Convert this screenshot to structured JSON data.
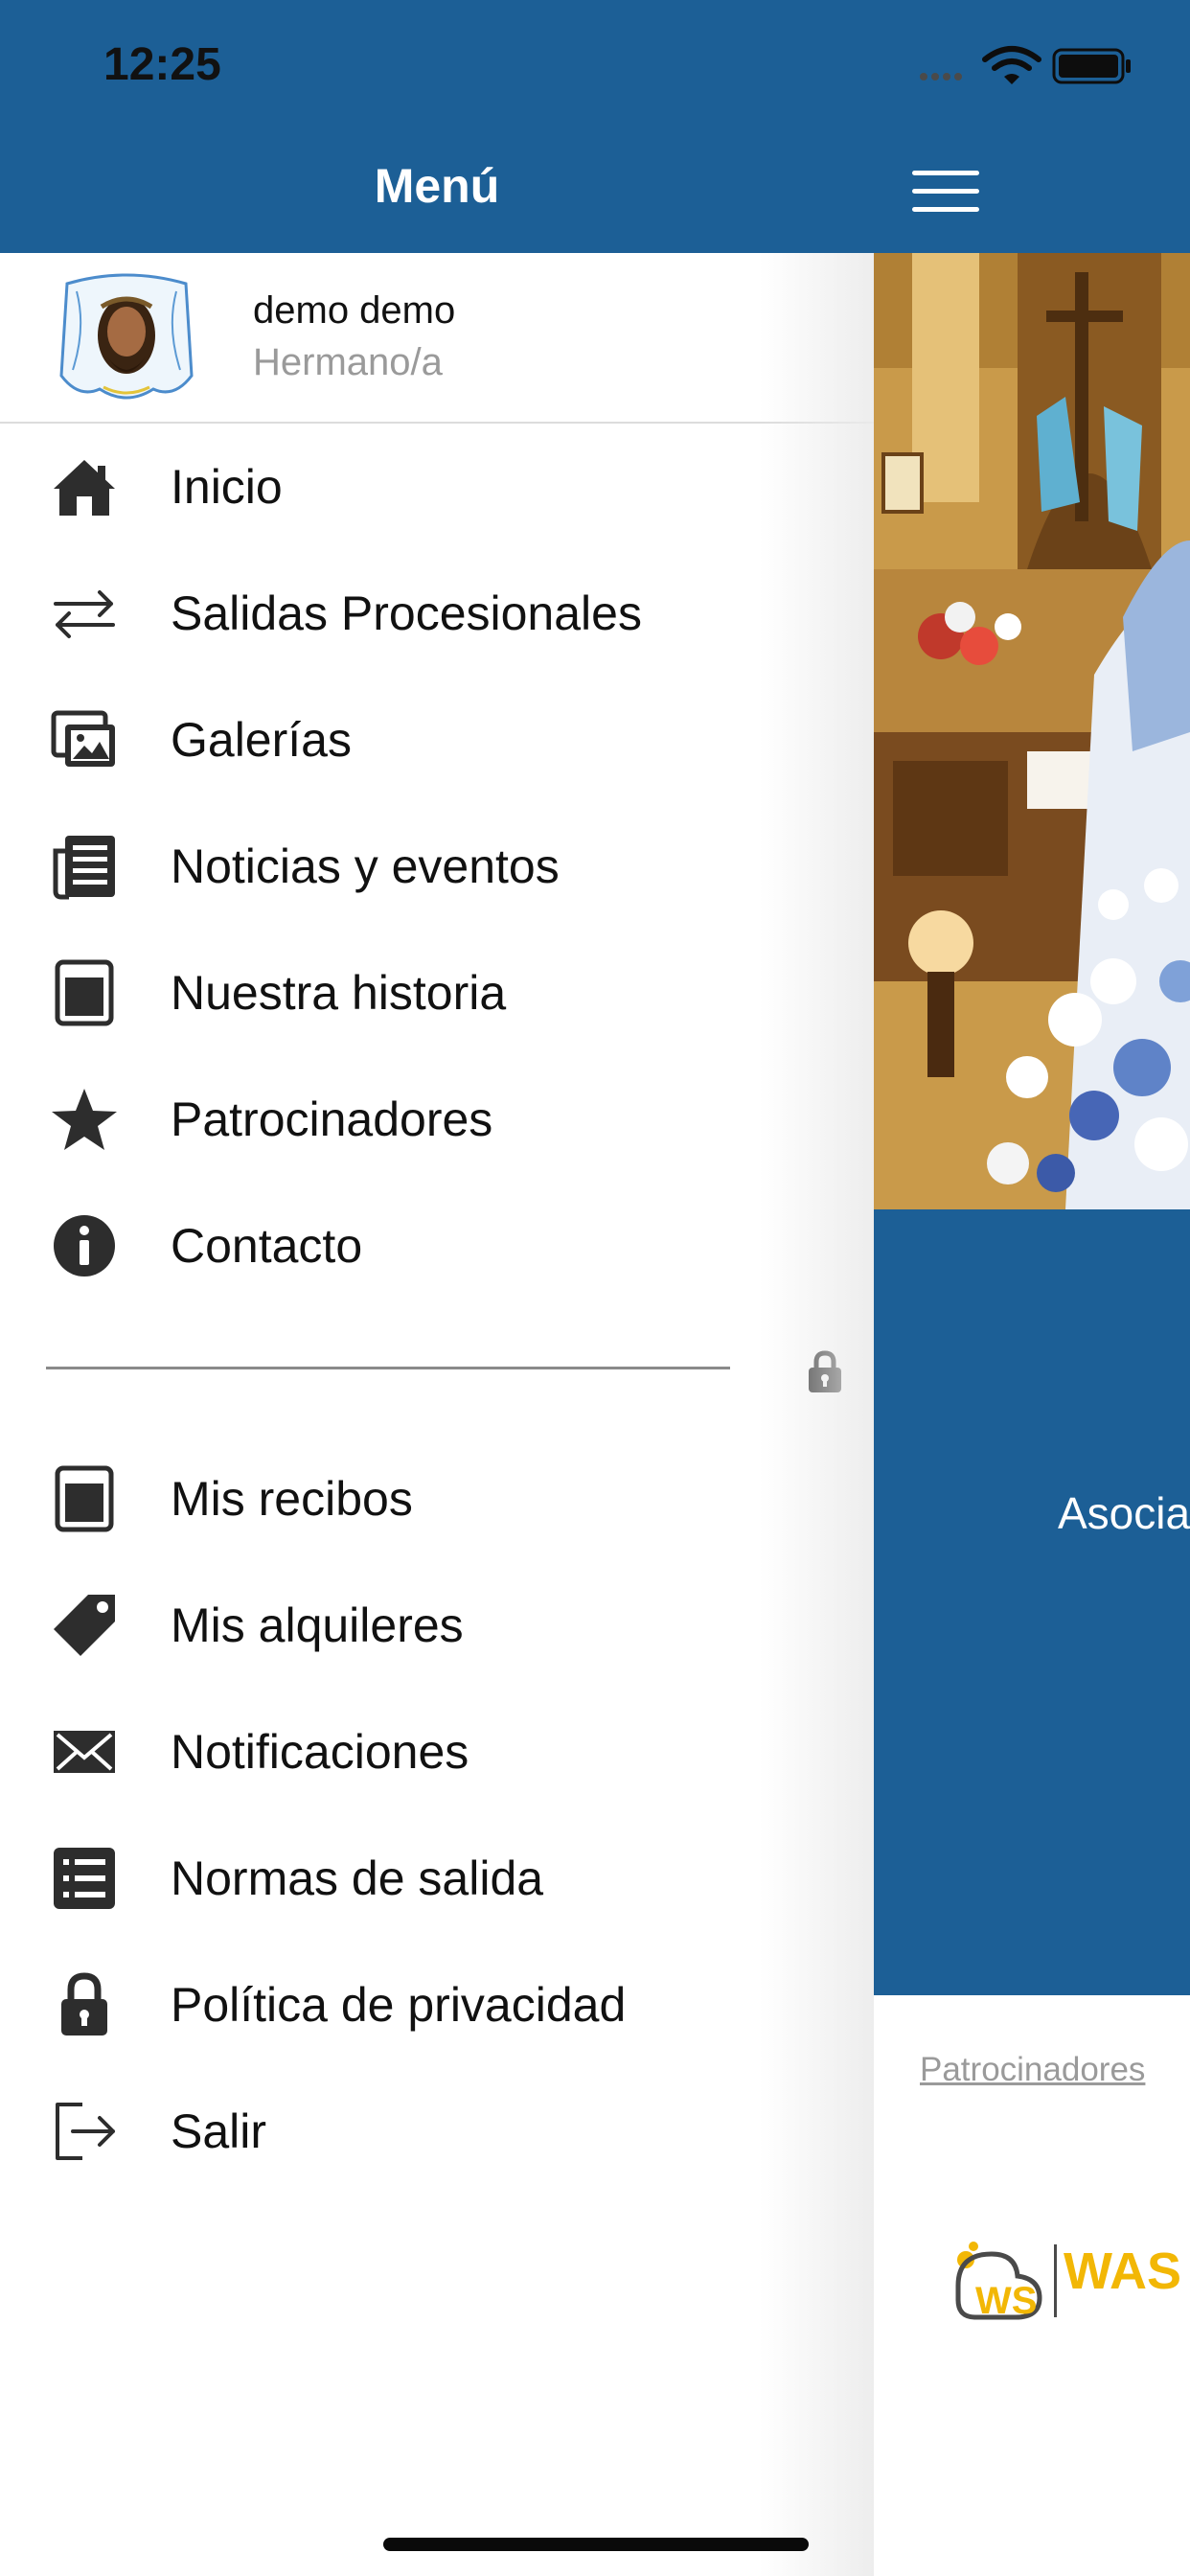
{
  "status_bar": {
    "time": "12:25"
  },
  "drawer": {
    "title": "Menú",
    "profile": {
      "name": "demo demo",
      "role": "Hermano/a"
    },
    "menu_items": [
      {
        "label": "Inicio",
        "icon": "home-icon"
      },
      {
        "label": "Salidas Procesionales",
        "icon": "arrows-exchange-icon"
      },
      {
        "label": "Galerías",
        "icon": "gallery-icon"
      },
      {
        "label": "Noticias y eventos",
        "icon": "newspaper-icon"
      },
      {
        "label": "Nuestra historia",
        "icon": "book-icon"
      },
      {
        "label": "Patrocinadores",
        "icon": "star-icon"
      },
      {
        "label": "Contacto",
        "icon": "info-icon"
      }
    ],
    "private_items": [
      {
        "label": "Mis recibos",
        "icon": "receipt-icon"
      },
      {
        "label": "Mis alquileres",
        "icon": "tag-icon"
      },
      {
        "label": "Notificaciones",
        "icon": "envelope-icon"
      },
      {
        "label": "Normas de salida",
        "icon": "list-icon"
      },
      {
        "label": "Política de privacidad",
        "icon": "lock-icon"
      },
      {
        "label": "Salir",
        "icon": "logout-icon"
      }
    ]
  },
  "main": {
    "band_text": "Asocia",
    "sponsors_link": "Patrocinadores",
    "sponsor_logo_text": "WAS SERVI",
    "sponsor_logo_initials": "WS"
  },
  "colors": {
    "primary": "#1c5f96",
    "text": "#111111",
    "muted": "#9a9a9a"
  }
}
